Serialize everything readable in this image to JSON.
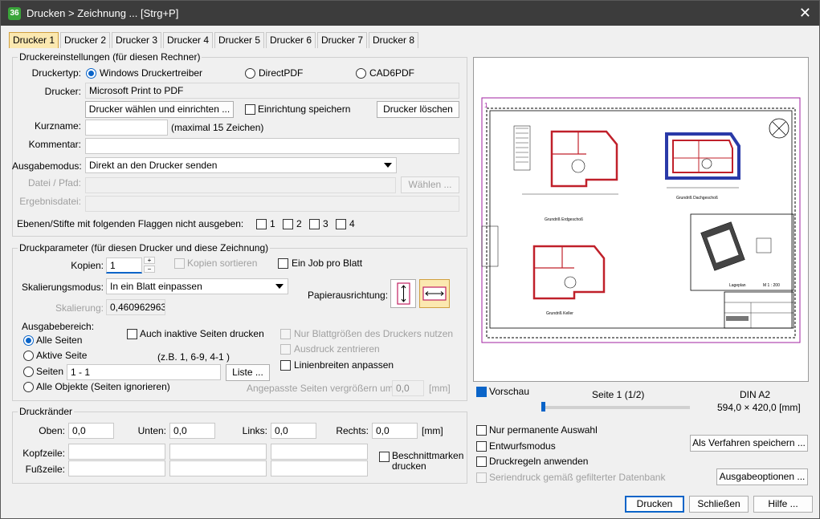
{
  "window": {
    "title": "Drucken > Zeichnung ... [Strg+P]",
    "app_icon": "app-logo-icon",
    "app_icon_text": "36"
  },
  "tabs": [
    "Drucker 1",
    "Drucker 2",
    "Drucker 3",
    "Drucker 4",
    "Drucker 5",
    "Drucker 6",
    "Drucker 7",
    "Drucker 8"
  ],
  "printer_settings": {
    "group_title": "Druckereinstellungen (für diesen Rechner)",
    "type_label": "Druckertyp:",
    "type_options": [
      "Windows Druckertreiber",
      "DirectPDF",
      "CAD6PDF"
    ],
    "printer_label": "Drucker:",
    "printer_value": "Microsoft Print to PDF",
    "choose_button": "Drucker wählen und einrichten ...",
    "save_setup_label": "Einrichtung speichern",
    "delete_button": "Drucker löschen",
    "shortname_label": "Kurzname:",
    "shortname_value": "",
    "shortname_hint": "(maximal 15 Zeichen)",
    "comment_label": "Kommentar:",
    "comment_value": "",
    "output_label": "Ausgabemodus:",
    "output_value": "Direkt an den Drucker senden",
    "file_label": "Datei / Pfad:",
    "file_value": "",
    "choose_file_button": "Wählen ...",
    "result_label": "Ergebnisdatei:",
    "result_value": "",
    "layers_label": "Ebenen/Stifte mit folgenden Flaggen nicht ausgeben:",
    "flags": [
      "1",
      "2",
      "3",
      "4"
    ]
  },
  "print_params": {
    "group_title": "Druckparameter (für diesen Drucker und diese Zeichnung)",
    "copies_label": "Kopien:",
    "copies_value": "1",
    "sort_copies_label": "Kopien sortieren",
    "one_job_label": "Ein Job pro Blatt",
    "scale_mode_label": "Skalierungsmodus:",
    "scale_mode_value": "In ein Blatt einpassen",
    "paper_orientation_label": "Papierausrichtung:",
    "scale_label": "Skalierung:",
    "scale_value": "0,460962963",
    "range_label": "Ausgabebereich:",
    "range_options": [
      "Alle Seiten",
      "Aktive Seite",
      "Seiten",
      "Alle Objekte (Seiten ignorieren)"
    ],
    "inactive_pages_label": "Auch inaktive Seiten drucken",
    "example_hint": "(z.B. 1, 6-9, 4-1 )",
    "pages_value": "1 - 1",
    "list_button": "Liste ...",
    "only_paper_sizes_label": "Nur Blattgrößen des Druckers nutzen",
    "center_label": "Ausdruck zentrieren",
    "line_width_label": "Linienbreiten anpassen",
    "enlarge_label": "Angepasste Seiten vergrößern um:",
    "enlarge_value": "0,0",
    "enlarge_unit": "[mm]"
  },
  "margins": {
    "group_title": "Druckränder",
    "top_label": "Oben:",
    "top_value": "0,0",
    "bottom_label": "Unten:",
    "bottom_value": "0,0",
    "left_label": "Links:",
    "left_value": "0,0",
    "right_label": "Rechts:",
    "right_value": "0,0",
    "unit": "[mm]",
    "header_label": "Kopfzeile:",
    "footer_label": "Fußzeile:",
    "crop_marks_label": "Beschnittmarken drucken"
  },
  "preview": {
    "toggle_label": "Vorschau",
    "page_label": "Seite 1 (1/2)",
    "paper_name": "DIN A2",
    "paper_size": "594,0 × 420,0 [mm]",
    "page_number": "1",
    "plan_labels": [
      "Grundriß Erdgeschoß",
      "Grundriß Dachgeschoß",
      "Grundriß Keller",
      "Lageplan",
      "M 1 : 200"
    ]
  },
  "options": {
    "permanent_label": "Nur permanente Auswahl",
    "draft_label": "Entwurfsmodus",
    "rules_label": "Druckregeln anwenden",
    "serial_label": "Seriendruck gemäß gefilterter Datenbank",
    "save_procedure_button": "Als Verfahren speichern ...",
    "output_options_button": "Ausgabeoptionen ..."
  },
  "footer": {
    "print_button": "Drucken",
    "close_button": "Schließen",
    "help_button": "Hilfe ..."
  },
  "colors": {
    "accent": "#0a64c8",
    "title_bar": "#3c3c3c",
    "active_tab": "#fbe8b0",
    "walls": "#c0202a",
    "roof": "#2a3aa8",
    "sheet_border": "#a020a0"
  }
}
